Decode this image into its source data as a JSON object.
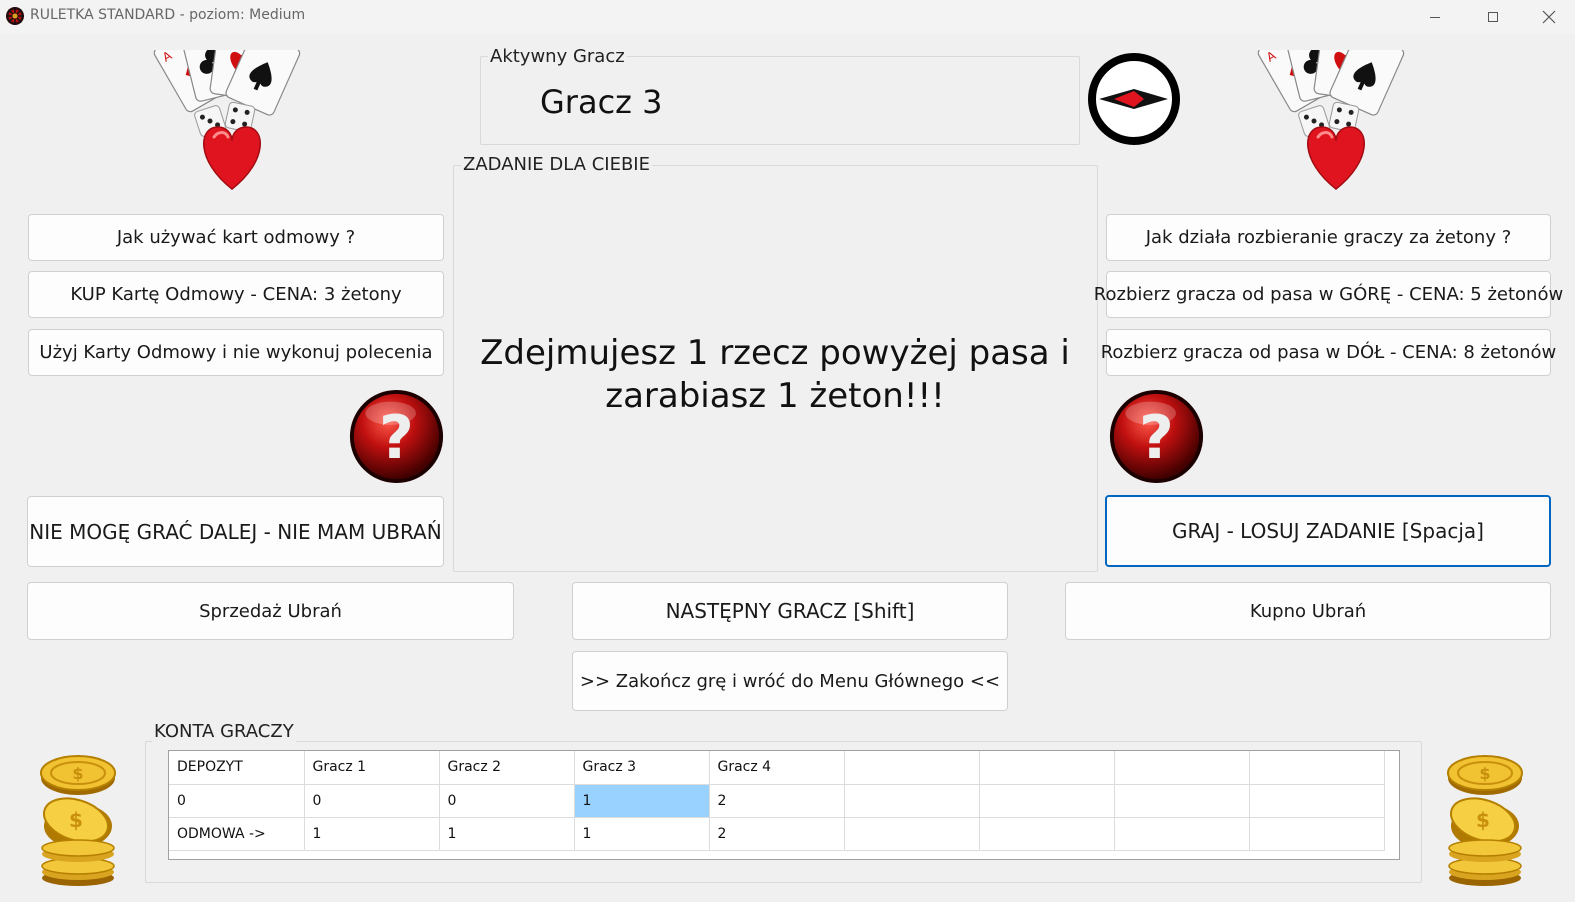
{
  "window": {
    "title": "RULETKA STANDARD - poziom: Medium",
    "controls": [
      "minimize",
      "maximize",
      "close"
    ]
  },
  "active_player": {
    "group_label": "Aktywny Gracz",
    "name": "Gracz 3"
  },
  "task": {
    "group_label": "ZADANIE DLA CIEBIE",
    "line1": "Zdejmujesz 1 rzecz powyżej pasa i",
    "line2": "zarabiasz 1 żeton!!!"
  },
  "left_panel": {
    "how_refusal_cards": "Jak używać kart odmowy ?",
    "buy_refusal_card": "KUP Kartę Odmowy - CENA: 3 żetony",
    "use_refusal_card": "Użyj Karty Odmowy i nie wykonuj polecenia",
    "cannot_play": "NIE MOGĘ GRAĆ DALEJ - NIE MAM UBRAŃ"
  },
  "right_panel": {
    "how_undressing": "Jak działa rozbieranie graczy za żetony ?",
    "undress_up": "Rozbierz gracza od pasa w GÓRĘ - CENA: 5 żetonów",
    "undress_down": "Rozbierz gracza od pasa w DÓŁ - CENA: 8 żetonów",
    "play_draw": "GRAJ - LOSUJ ZADANIE [Spacja]"
  },
  "bottom_buttons": {
    "sell_clothes": "Sprzedaż Ubrań",
    "next_player": "NASTĘPNY GRACZ [Shift]",
    "buy_clothes": "Kupno Ubrań",
    "end_game": ">> Zakończ grę i wróć do Menu Głównego <<"
  },
  "accounts": {
    "group_label": "KONTA GRACZY",
    "rows": [
      [
        "DEPOZYT",
        "Gracz 1",
        "Gracz 2",
        "Gracz 3",
        "Gracz 4",
        "",
        "",
        "",
        ""
      ],
      [
        "0",
        "0",
        "0",
        "1",
        "2",
        "",
        "",
        "",
        ""
      ],
      [
        "ODMOWA ->",
        "1",
        "1",
        "1",
        "2",
        "",
        "",
        "",
        ""
      ]
    ],
    "selected_cell": "row 2, column Gracz 3"
  },
  "icons": {
    "app": "roulette-icon",
    "cards_dice": "cards-dice-heart-icon",
    "direction": "direction-arrow-icon",
    "help": "question-mark-icon",
    "coins": "gold-coins-icon"
  },
  "colors": {
    "background": "#f0f0f0",
    "focus_border": "#0067c0",
    "selection": "#99d1ff",
    "heart_red": "#e0141e",
    "help_red": "#b50d0d"
  }
}
